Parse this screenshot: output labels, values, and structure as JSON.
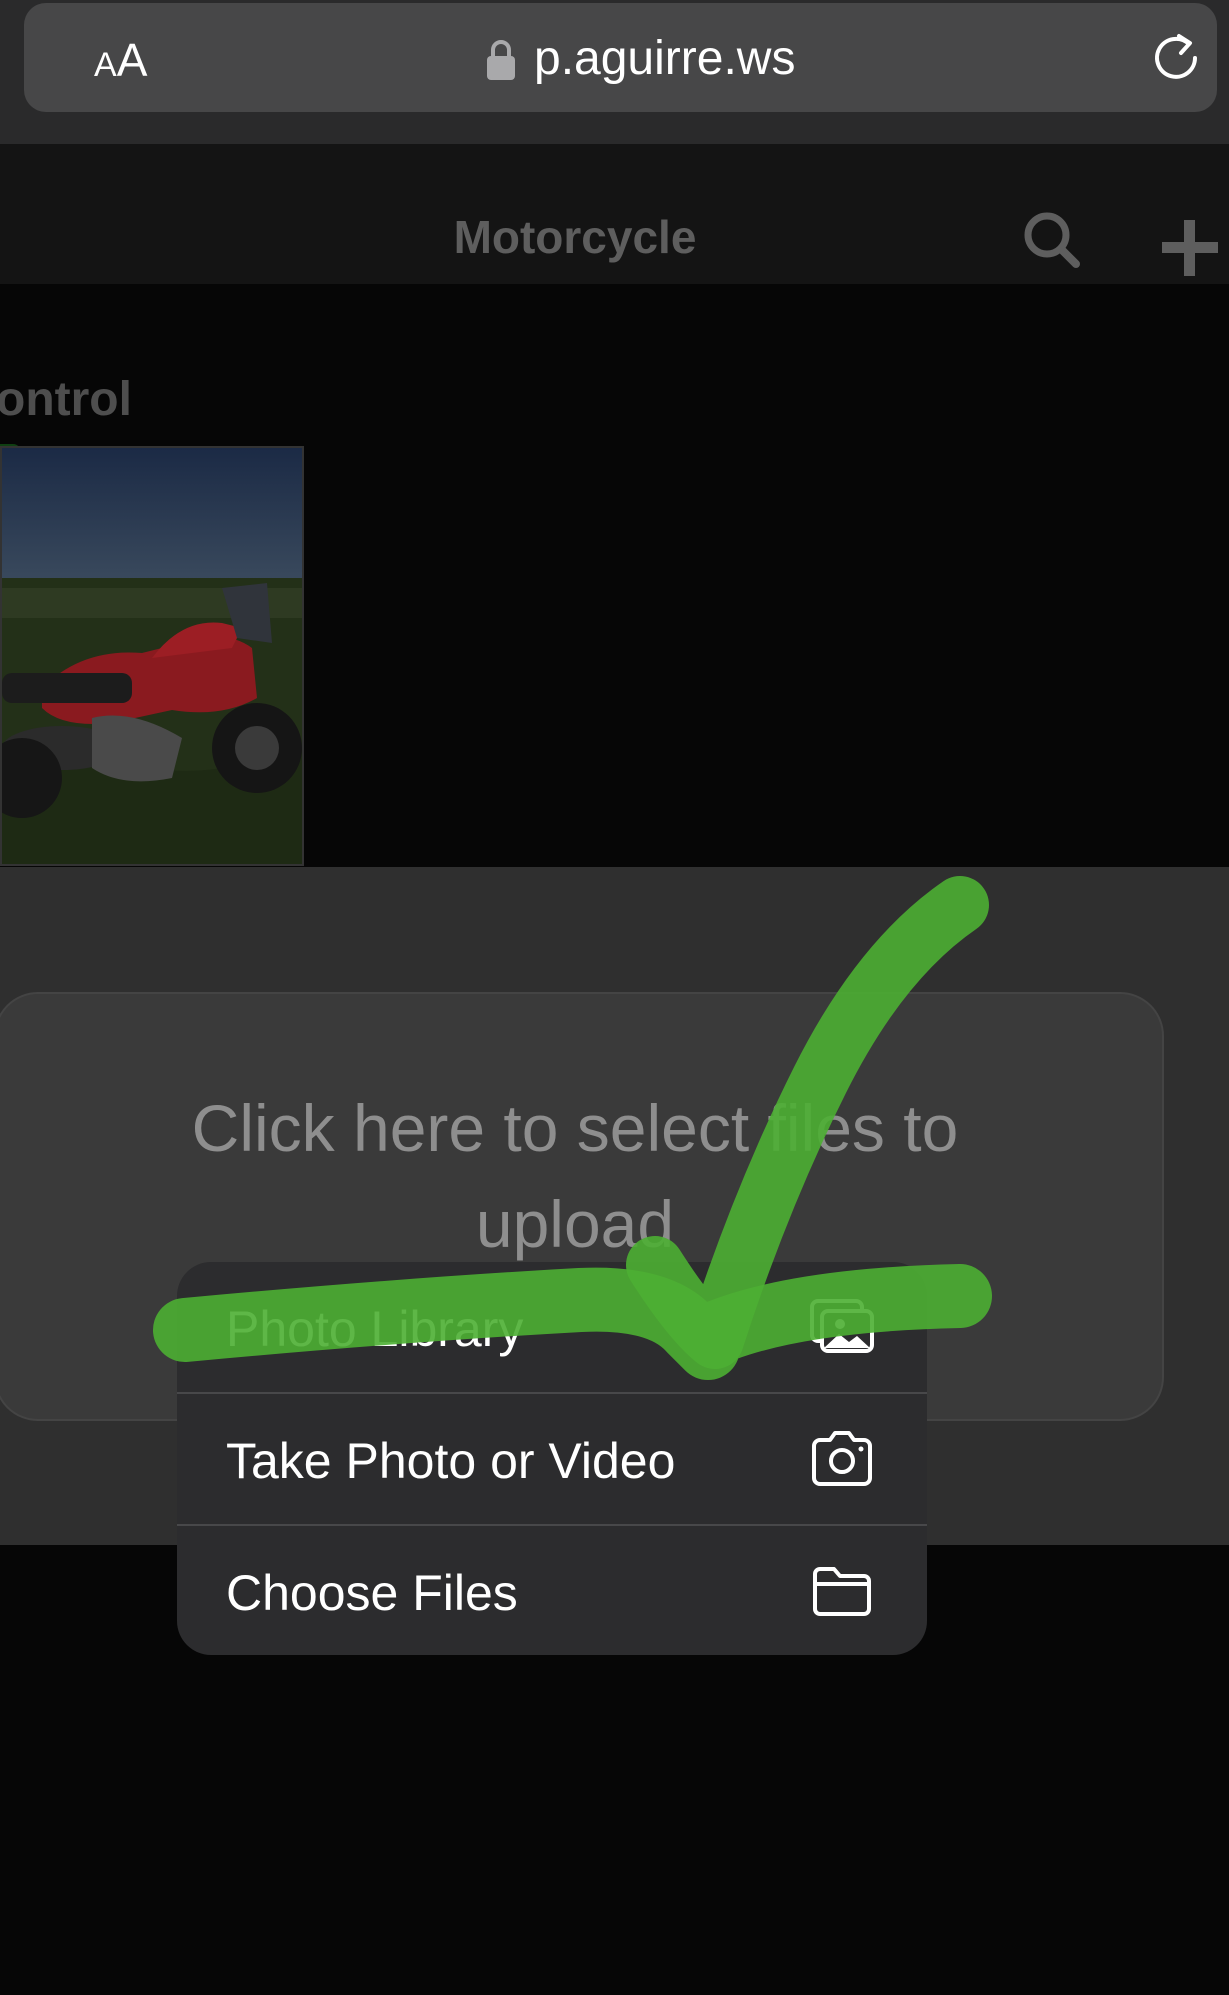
{
  "browser": {
    "text_size_small": "A",
    "text_size_large": "A",
    "url": "p.aguirre.ws"
  },
  "page": {
    "title": "Motorcycle",
    "section_label": "ontrol"
  },
  "upload": {
    "prompt": "Click here to select files to upload"
  },
  "menu": {
    "items": [
      {
        "label": "Photo Library",
        "icon": "photo-library-icon"
      },
      {
        "label": "Take Photo or Video",
        "icon": "camera-icon"
      },
      {
        "label": "Choose Files",
        "icon": "folder-icon"
      }
    ]
  },
  "colors": {
    "highlight": "#4caf33",
    "menu_bg": "#2c2c2e"
  }
}
